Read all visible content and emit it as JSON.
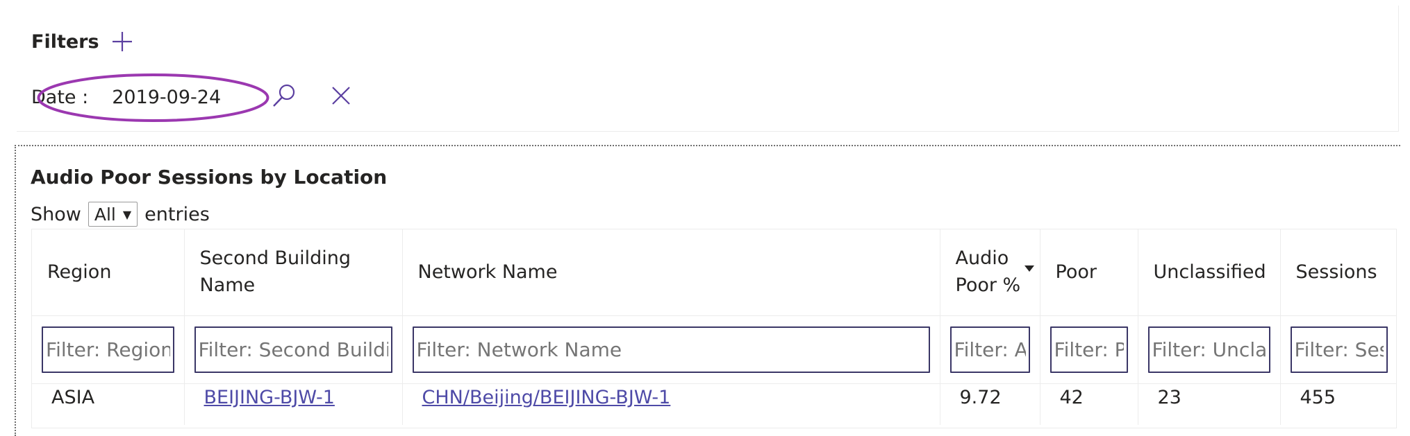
{
  "filters": {
    "title": "Filters",
    "date_filter": {
      "label": "Date :",
      "value": "2019-09-24"
    }
  },
  "report": {
    "title": "Audio Poor Sessions by Location",
    "length": {
      "prefix": "Show",
      "selected": "All",
      "suffix": "entries"
    },
    "columns": [
      {
        "label": "Region",
        "filter_placeholder": "Filter: Region"
      },
      {
        "label": "Second Building Name",
        "filter_placeholder": "Filter: Second Building Name"
      },
      {
        "label": "Network Name",
        "filter_placeholder": "Filter: Network Name"
      },
      {
        "label": "Audio Poor %",
        "filter_placeholder": "Filter: Audio Poor %",
        "sorted": "descending"
      },
      {
        "label": "Poor",
        "filter_placeholder": "Filter: Poor"
      },
      {
        "label": "Unclassified",
        "filter_placeholder": "Filter: Unclassified"
      },
      {
        "label": "Sessions",
        "filter_placeholder": "Filter: Sessions"
      }
    ],
    "rows": [
      {
        "region": "ASIA",
        "building": "BEIJING-BJW-1",
        "network": "CHN/Beijing/BEIJING-BJW-1",
        "audio_poor_pct": "9.72",
        "poor": "42",
        "unclassified": "23",
        "sessions": "455"
      }
    ]
  },
  "colors": {
    "accent": "#5b3fa0",
    "highlight_ellipse": "#9b38b0",
    "link": "#4e4aa7",
    "input_border": "#3a3666"
  },
  "icons": {
    "add_filter": "plus-icon",
    "search": "magnifier-icon",
    "clear": "close-icon",
    "sort": "caret-down-icon"
  }
}
